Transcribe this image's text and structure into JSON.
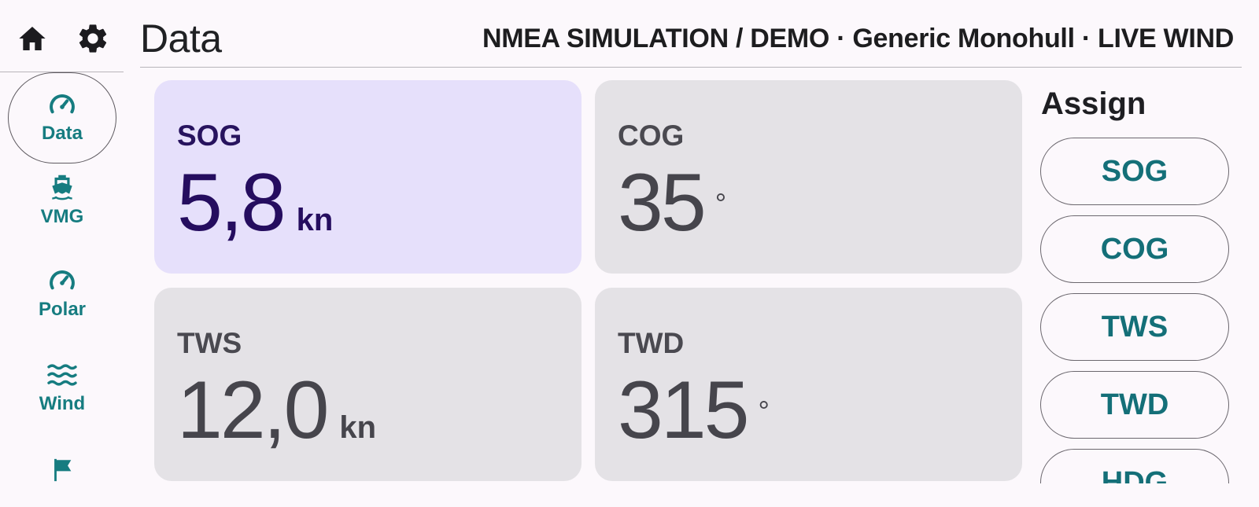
{
  "toolbar": {
    "home_icon": "home-icon",
    "settings_icon": "gear-icon"
  },
  "header": {
    "title": "Data",
    "status": "NMEA SIMULATION / DEMO · Generic Monohull · LIVE WIND"
  },
  "nav": {
    "items": [
      {
        "label": "Data",
        "icon": "speedometer-icon",
        "active": true
      },
      {
        "label": "VMG",
        "icon": "boat-icon",
        "active": false
      },
      {
        "label": "Polar",
        "icon": "speedometer-icon",
        "active": false
      },
      {
        "label": "Wind",
        "icon": "waves-icon",
        "active": false
      },
      {
        "label": "",
        "icon": "flag-icon",
        "active": false
      }
    ]
  },
  "tiles": [
    {
      "label": "SOG",
      "value": "5,8",
      "unit": "kn",
      "selected": true
    },
    {
      "label": "COG",
      "value": "35",
      "unit": "°",
      "selected": false
    },
    {
      "label": "TWS",
      "value": "12,0",
      "unit": "kn",
      "selected": false
    },
    {
      "label": "TWD",
      "value": "315",
      "unit": "°",
      "selected": false
    }
  ],
  "assign": {
    "title": "Assign",
    "options": [
      "SOG",
      "COG",
      "TWS",
      "TWD",
      "HDG"
    ]
  },
  "colors": {
    "accent_teal": "#167c80",
    "selected_tile_bg": "#e6e0fb",
    "tile_bg": "#e4e2e6",
    "selected_text": "#250d5f",
    "background": "#fcf8fc"
  }
}
